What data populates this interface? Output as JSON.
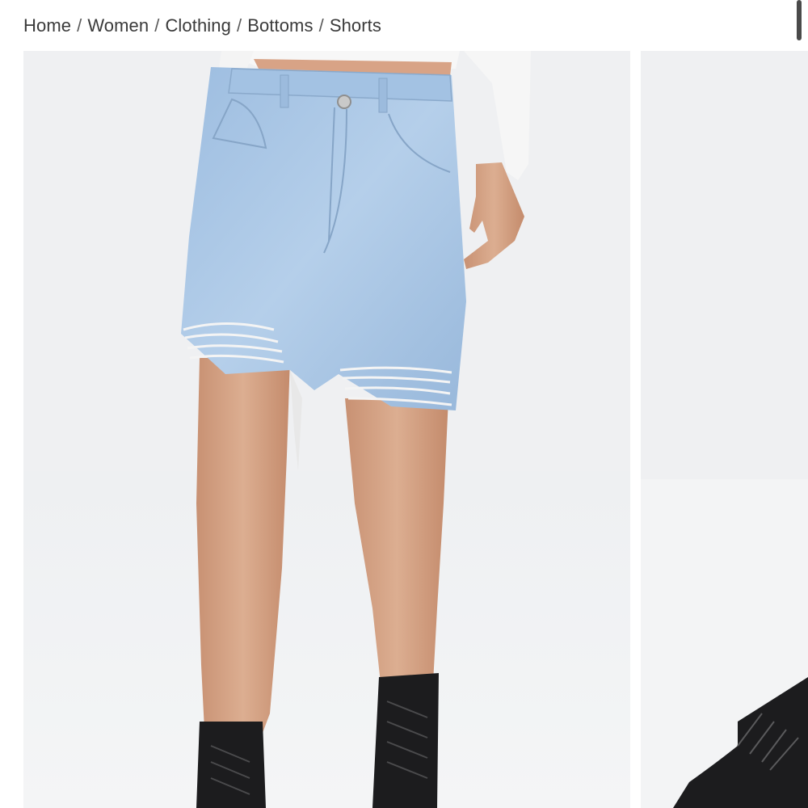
{
  "breadcrumb": {
    "items": [
      {
        "label": "Home"
      },
      {
        "label": "Women"
      },
      {
        "label": "Clothing"
      },
      {
        "label": "Bottoms"
      },
      {
        "label": "Shorts"
      }
    ],
    "separator": "/"
  },
  "gallery": {
    "images": [
      {
        "name": "product-photo-main",
        "subject": "light-wash distressed denim shorts with black combat boots"
      },
      {
        "name": "product-photo-next",
        "subject": "black combat boot (partial)"
      }
    ]
  },
  "colors": {
    "denim": "#a9c5e3",
    "photo_background": "#eff0f2",
    "skin": "#d9a88a",
    "boot": "#1c1c1e",
    "text": "#3a3a3a"
  }
}
